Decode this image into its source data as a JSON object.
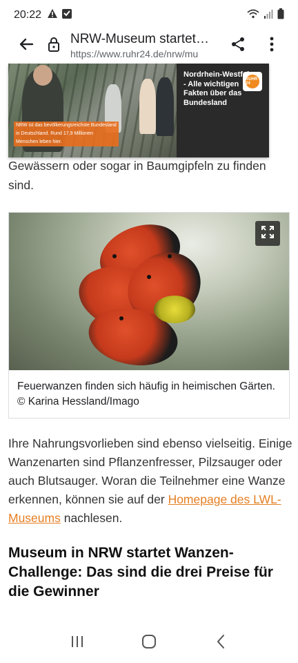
{
  "status_bar": {
    "time": "20:22",
    "icons": [
      "warning-icon",
      "download-icon",
      "wifi-icon",
      "signal-icon",
      "battery-icon"
    ]
  },
  "browser": {
    "page_title": "NRW-Museum startet…",
    "url": "https://www.ruhr24.de/nrw/mu",
    "icons": {
      "back": "back-arrow-icon",
      "lock": "lock-icon",
      "share": "share-icon",
      "menu": "more-vert-icon"
    }
  },
  "article": {
    "video_card": {
      "panel_title": "Nordrhein-Westfalen - Alle wichtigen Fakten über das Bundesland",
      "badge_text": "RUHR 24",
      "caption_lines": [
        "NRW ist das bevölkerungsreichste Bundesland",
        "in Deutschland. Rund 17,9 Millionen",
        "Menschen leben hier."
      ]
    },
    "top_paragraph": "Gewässern oder sogar in Baumgipfeln zu finden sind.",
    "figure": {
      "caption": "Feuerwanzen finden sich häufig in heimischen Gärten.    © Karina Hessland/Imago",
      "expand_icon": "fullscreen-icon"
    },
    "body_paragraph_before_link": "Ihre Nahrungsvorlieben sind ebenso vielseitig. Einige Wanzenarten sind Pflanzenfresser, Pilzsauger oder auch Blutsauger. Woran die Teilnehmer eine Wanze erkennen, können sie auf der ",
    "body_link_text": "Homepage des LWL-Museums",
    "body_paragraph_after_link": " nachlesen.",
    "section_heading": "Museum in NRW startet Wanzen-Challenge: Das sind die drei Preise für die Gewinner"
  },
  "nav_bar": {
    "icons": [
      "recent-apps-icon",
      "home-icon",
      "nav-back-icon"
    ]
  },
  "colors": {
    "link": "#e67e22",
    "badge": "#f08a1e",
    "video_panel": "#2a2a2a"
  }
}
